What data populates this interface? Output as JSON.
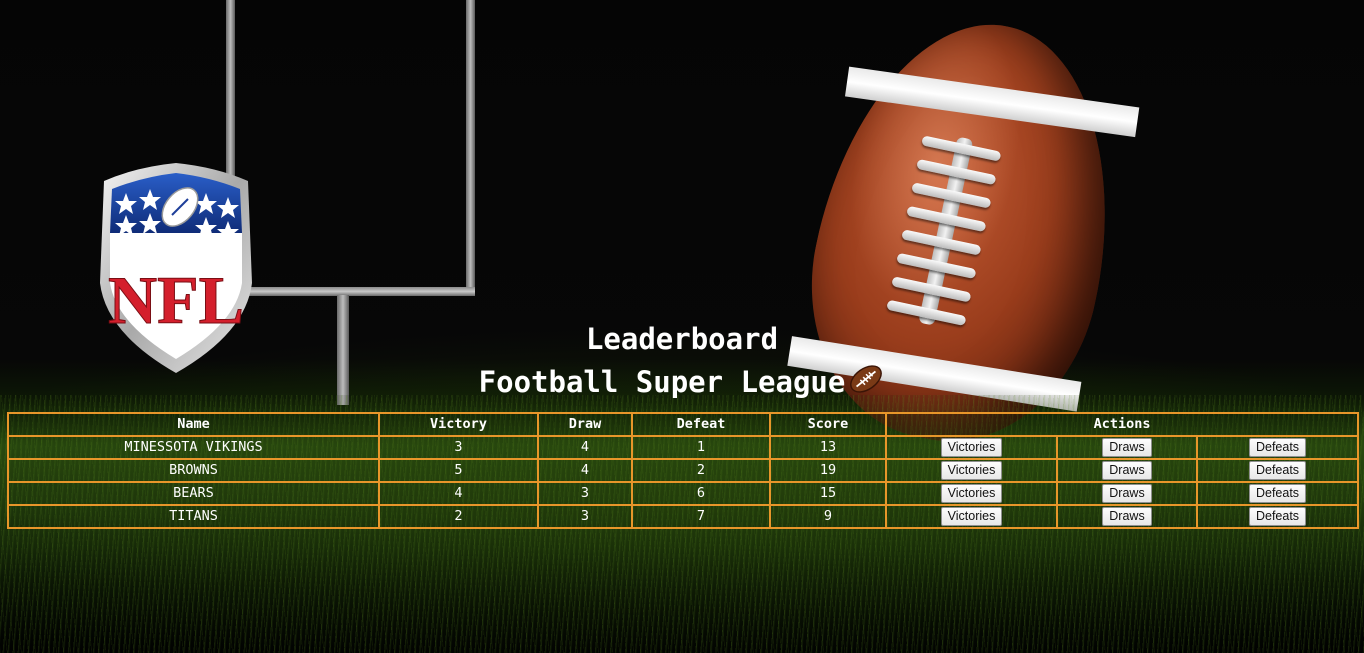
{
  "header": {
    "title": "Leaderboard",
    "subtitle": "Football Super League"
  },
  "icons": {
    "logo": "nfl-shield-logo",
    "title_emoji": "american-football-emoji"
  },
  "colors": {
    "table_border": "#e8962a",
    "text": "#ffffff",
    "background": "#000000"
  },
  "table": {
    "columns": [
      "Name",
      "Victory",
      "Draw",
      "Defeat",
      "Score",
      "Actions"
    ],
    "rows": [
      {
        "name": "MINESSOTA VIKINGS",
        "victory": "3",
        "draw": "4",
        "defeat": "1",
        "score": "13"
      },
      {
        "name": "BROWNS",
        "victory": "5",
        "draw": "4",
        "defeat": "2",
        "score": "19"
      },
      {
        "name": "BEARS",
        "victory": "4",
        "draw": "3",
        "defeat": "6",
        "score": "15"
      },
      {
        "name": "TITANS",
        "victory": "2",
        "draw": "3",
        "defeat": "7",
        "score": "9"
      }
    ],
    "actions": {
      "victories_label": "Victories",
      "draws_label": "Draws",
      "defeats_label": "Defeats"
    }
  }
}
